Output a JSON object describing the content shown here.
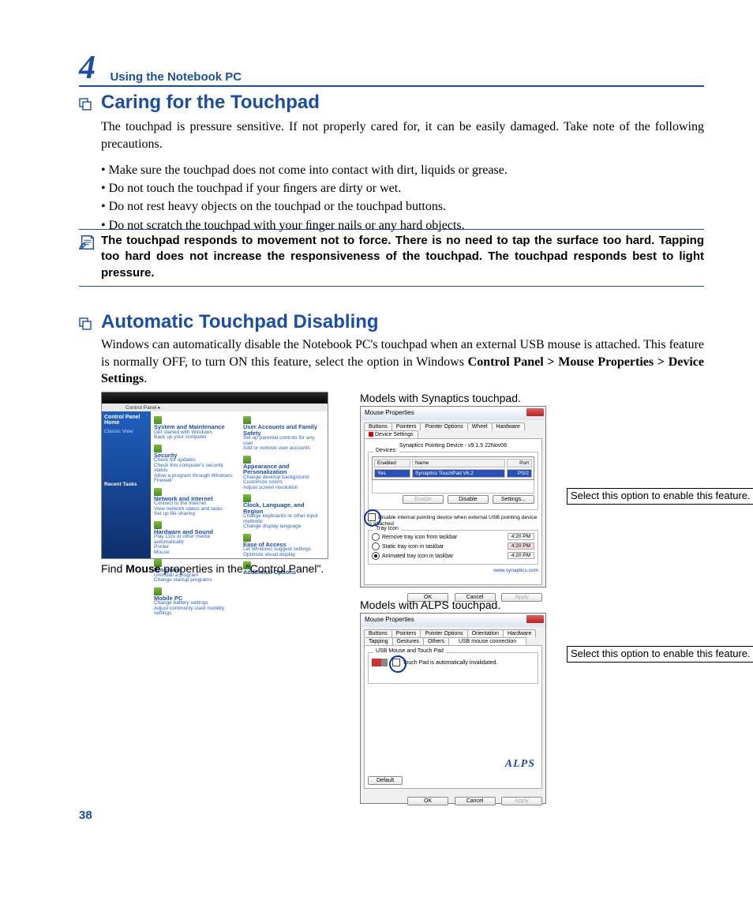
{
  "chapter": {
    "number": "4",
    "title": "Using the Notebook PC"
  },
  "page_number": "38",
  "section1": {
    "heading": "Caring for the Touchpad",
    "intro": "The touchpad is pressure sensitive. If not properly cared for, it can be easily damaged. Take note of the following precautions.",
    "bullets": [
      "Make sure the touchpad does not come into contact with dirt, liquids or grease.",
      "Do not touch the touchpad if your ﬁngers are dirty or wet.",
      "Do not rest heavy objects on the touchpad or the touchpad buttons.",
      "Do not scratch the touchpad with your ﬁnger nails or any hard objects."
    ],
    "note": "The touchpad responds to movement not to force. There is no need to tap the surface too hard. Tapping too hard does not increase the responsiveness of the touchpad. The touchpad responds best to light pressure."
  },
  "section2": {
    "heading": "Automatic Touchpad Disabling",
    "intro_pre": "Windows can automatically disable the Notebook PC's touchpad when an external USB mouse is attached. This feature is normally OFF, to turn ON this feature, select the option in Windows ",
    "intro_bold": "Control Panel > Mouse Properties > Device Settings",
    "intro_post": "."
  },
  "caption1_pre": "Find ",
  "caption1_b": "Mouse",
  "caption1_post": " properties in the \"Control Panel\".",
  "caption2": "Models with Synaptics touchpad.",
  "caption3": "Models with ALPS touchpad.",
  "callout": "Select this option to enable this feature.",
  "control_panel": {
    "breadcrumb": "Control Panel ▸",
    "side_head": "Control Panel Home",
    "side_classic": "Classic View",
    "side_recent": "Recent Tasks",
    "left": [
      {
        "t": "System and Maintenance",
        "s": [
          "Get started with Windows",
          "Back up your computer"
        ]
      },
      {
        "t": "Security",
        "s": [
          "Check for updates",
          "Check this computer's security status",
          "Allow a program through Windows Firewall"
        ]
      },
      {
        "t": "Network and Internet",
        "s": [
          "Connect to the Internet",
          "View network status and tasks",
          "Set up file sharing"
        ]
      },
      {
        "t": "Hardware and Sound",
        "s": [
          "Play CDs or other media automatically",
          "Printer",
          "Mouse"
        ]
      },
      {
        "t": "Programs",
        "s": [
          "Uninstall a program",
          "Change startup programs"
        ]
      },
      {
        "t": "Mobile PC",
        "s": [
          "Change battery settings",
          "Adjust commonly used mobility settings"
        ]
      }
    ],
    "right": [
      {
        "t": "User Accounts and Family Safety",
        "s": [
          "Set up parental controls for any user",
          "Add or remove user accounts"
        ]
      },
      {
        "t": "Appearance and Personalization",
        "s": [
          "Change desktop background",
          "Customize colors",
          "Adjust screen resolution"
        ]
      },
      {
        "t": "Clock, Language, and Region",
        "s": [
          "Change keyboards or other input methods",
          "Change display language"
        ]
      },
      {
        "t": "Ease of Access",
        "s": [
          "Let Windows suggest settings",
          "Optimize visual display"
        ]
      },
      {
        "t": "Additional Options",
        "s": []
      }
    ]
  },
  "syn": {
    "title": "Mouse Properties",
    "tabs": [
      "Buttons",
      "Pointers",
      "Pointer Options",
      "Wheel",
      "Hardware",
      "Device Settings"
    ],
    "subtitle": "Synaptics Pointing Device - v9.1.5 22Nov06",
    "devices_label": "Devices:",
    "th": [
      "Enabled",
      "Name",
      "Port"
    ],
    "row": [
      "Yes",
      "Synaptics TouchPad V6.2",
      "PS/2"
    ],
    "btns": [
      "Enable",
      "Disable",
      "Settings..."
    ],
    "disable_opt": "Disable internal pointing device when external USB pointing device is attached",
    "tray_label": "Tray Icon",
    "tray": [
      "Remove tray icon from taskbar",
      "Static tray icon in taskbar",
      "Animated tray icon in taskbar"
    ],
    "time": "4:20 PM",
    "link": "www.synaptics.com",
    "ok": "OK",
    "cancel": "Cancel",
    "apply": "Apply"
  },
  "alps": {
    "title": "Mouse Properties",
    "tabs_row1": [
      "Buttons",
      "Pointers",
      "Pointer Options",
      "Orientation",
      "Hardware"
    ],
    "tabs_row2": [
      "Tapping",
      "Gestures",
      "Others",
      "USB mouse connection"
    ],
    "group": "USB Mouse and Touch Pad",
    "opt": "Touch Pad is automatically invalidated.",
    "logo": "ALPS",
    "default": "Default",
    "ok": "OK",
    "cancel": "Cancel",
    "apply": "Apply"
  }
}
